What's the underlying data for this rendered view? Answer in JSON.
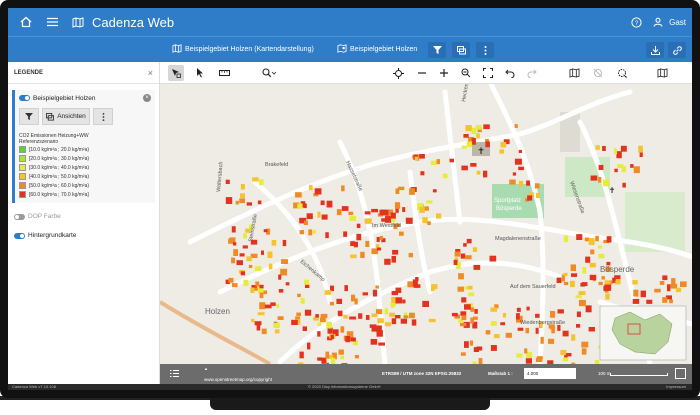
{
  "header": {
    "app_title": "Cadenza Web",
    "user": "Gast"
  },
  "tabs": [
    {
      "label": "Beispielgebiet Holzen (Kartendarstellung)"
    },
    {
      "label": "Beispielgebiet Holzen"
    }
  ],
  "sidebar": {
    "title": "LEGENDE",
    "layer_name": "Beispielgebiet Holzen",
    "views_button": "Ansichten",
    "legend_title_1": "CO2 Emissionen Heizung+WW",
    "legend_title_2": "Referenzszenario",
    "legend_items": [
      {
        "label": "[10.0 kg/m²a ; 20.0 kg/m²a)",
        "color": "#4fdc2e"
      },
      {
        "label": "[20.0 kg/m²a ; 30.0 kg/m²a)",
        "color": "#a6e830"
      },
      {
        "label": "[30.0 kg/m²a ; 40.0 kg/m²a)",
        "color": "#e6ec3a"
      },
      {
        "label": "[40.0 kg/m²a ; 50.0 kg/m²a)",
        "color": "#f4c430"
      },
      {
        "label": "[50.0 kg/m²a ; 60.0 kg/m²a)",
        "color": "#f08a24"
      },
      {
        "label": "[60.0 kg/m²a ; 70.0 kg/m²a]",
        "color": "#e2331f"
      }
    ],
    "layer_dop": "DOP Farbe",
    "layer_background": "Hintergrundkarte"
  },
  "map": {
    "labels": {
      "heckenstrasse": "Heckenstraße",
      "brakefeld": "Brakefeld",
      "steinstrasse": "Steinstraße",
      "hasselstrasse": "Hasselstraße",
      "im_west": "Im Westfeld",
      "sportplatz_1": "Sportplatz",
      "sportplatz_2": "Bösperde",
      "magdalenen": "Magdalenenstraße",
      "boesperde": "Bösperde",
      "wiesen": "Wiesenstraße",
      "holzen": "Holzen",
      "wiedenberg": "Wiedenbergstraße",
      "auf_dem_sauerfeld": "Auf dem Sauerfeld",
      "eichenkamp": "Eichenkamp",
      "waltersbach": "Waltersbach"
    }
  },
  "status": {
    "attribution": "www.openstreetmap.org/copyright",
    "crs": "ETRS89 / UTM zone 32N EPSG:25832",
    "scale_label": "Maßstab 1 :",
    "scale_value": "4.000",
    "scalebar": "100 m"
  },
  "footer": {
    "version": "Cadenza Web v7.10.108",
    "copyright": "© 2020 Disy Informationssysteme GmbH",
    "impressum": "Impressum"
  },
  "colors": {
    "primary": "#2f7cc8",
    "building_red": "#e2331f",
    "building_orange": "#f08a24",
    "building_yellow": "#e6ec3a"
  }
}
